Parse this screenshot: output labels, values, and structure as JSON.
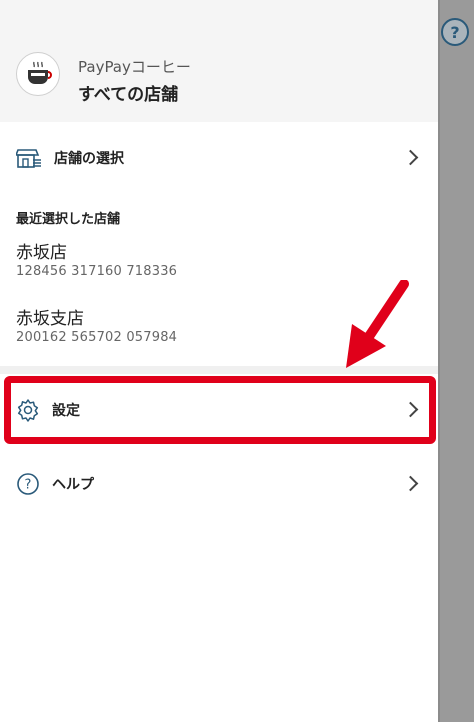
{
  "header": {
    "brand": "PayPayコーヒー",
    "shop_scope": "すべての店舗"
  },
  "menu": {
    "store_select_label": "店舗の選択",
    "recent_title": "最近選択した店舗",
    "recent_stores": [
      {
        "name": "赤坂店",
        "code": "128456 317160 718336"
      },
      {
        "name": "赤坂支店",
        "code": "200162 565702 057984"
      }
    ],
    "settings_label": "設定",
    "help_label": "ヘルプ"
  },
  "help_fab": "?",
  "colors": {
    "highlight": "#e0001a",
    "icon_blue": "#2a5a7a"
  }
}
